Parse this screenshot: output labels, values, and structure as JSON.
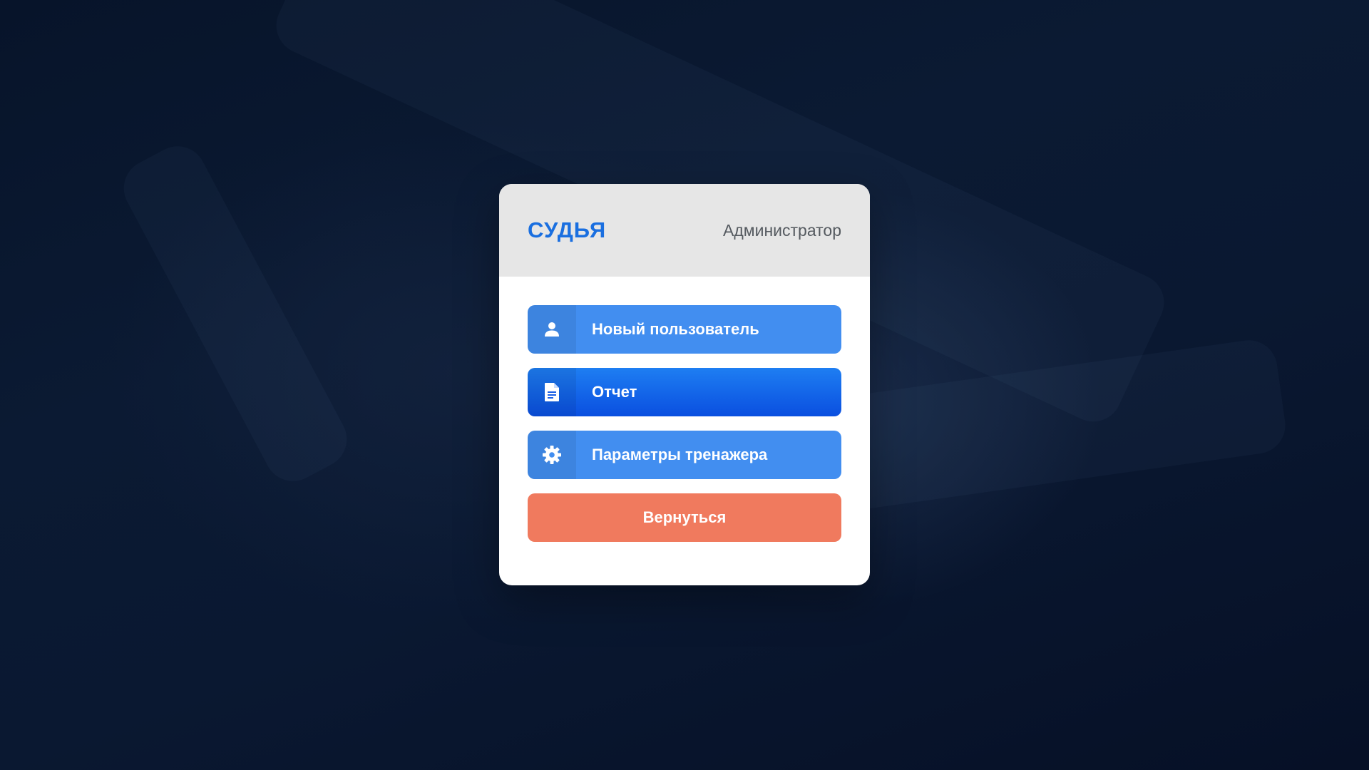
{
  "header": {
    "brand": "СУДЬЯ",
    "role": "Администратор"
  },
  "menu": [
    {
      "label": "Новый пользователь",
      "icon": "user-icon"
    },
    {
      "label": "Отчет",
      "icon": "document-icon",
      "active": true
    },
    {
      "label": "Параметры тренажера",
      "icon": "gear-icon"
    }
  ],
  "back_button": {
    "label": "Вернуться"
  },
  "colors": {
    "brand": "#1a6fe0",
    "menu_button": "#428ef0",
    "menu_button_active": "#0a4fe0",
    "back_button": "#f07a5e",
    "header_bg": "#e6e6e6"
  }
}
